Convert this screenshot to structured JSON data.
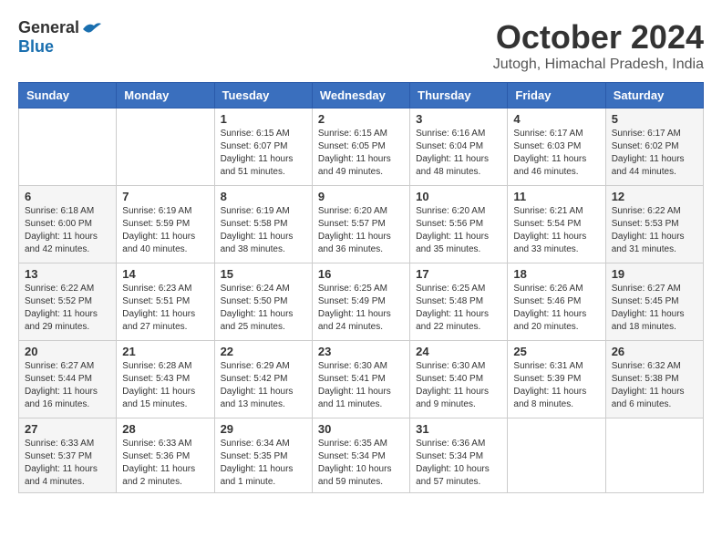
{
  "logo": {
    "general": "General",
    "blue": "Blue"
  },
  "title": "October 2024",
  "location": "Jutogh, Himachal Pradesh, India",
  "headers": [
    "Sunday",
    "Monday",
    "Tuesday",
    "Wednesday",
    "Thursday",
    "Friday",
    "Saturday"
  ],
  "weeks": [
    [
      {
        "day": "",
        "info": ""
      },
      {
        "day": "",
        "info": ""
      },
      {
        "day": "1",
        "info": "Sunrise: 6:15 AM\nSunset: 6:07 PM\nDaylight: 11 hours and 51 minutes."
      },
      {
        "day": "2",
        "info": "Sunrise: 6:15 AM\nSunset: 6:05 PM\nDaylight: 11 hours and 49 minutes."
      },
      {
        "day": "3",
        "info": "Sunrise: 6:16 AM\nSunset: 6:04 PM\nDaylight: 11 hours and 48 minutes."
      },
      {
        "day": "4",
        "info": "Sunrise: 6:17 AM\nSunset: 6:03 PM\nDaylight: 11 hours and 46 minutes."
      },
      {
        "day": "5",
        "info": "Sunrise: 6:17 AM\nSunset: 6:02 PM\nDaylight: 11 hours and 44 minutes."
      }
    ],
    [
      {
        "day": "6",
        "info": "Sunrise: 6:18 AM\nSunset: 6:00 PM\nDaylight: 11 hours and 42 minutes."
      },
      {
        "day": "7",
        "info": "Sunrise: 6:19 AM\nSunset: 5:59 PM\nDaylight: 11 hours and 40 minutes."
      },
      {
        "day": "8",
        "info": "Sunrise: 6:19 AM\nSunset: 5:58 PM\nDaylight: 11 hours and 38 minutes."
      },
      {
        "day": "9",
        "info": "Sunrise: 6:20 AM\nSunset: 5:57 PM\nDaylight: 11 hours and 36 minutes."
      },
      {
        "day": "10",
        "info": "Sunrise: 6:20 AM\nSunset: 5:56 PM\nDaylight: 11 hours and 35 minutes."
      },
      {
        "day": "11",
        "info": "Sunrise: 6:21 AM\nSunset: 5:54 PM\nDaylight: 11 hours and 33 minutes."
      },
      {
        "day": "12",
        "info": "Sunrise: 6:22 AM\nSunset: 5:53 PM\nDaylight: 11 hours and 31 minutes."
      }
    ],
    [
      {
        "day": "13",
        "info": "Sunrise: 6:22 AM\nSunset: 5:52 PM\nDaylight: 11 hours and 29 minutes."
      },
      {
        "day": "14",
        "info": "Sunrise: 6:23 AM\nSunset: 5:51 PM\nDaylight: 11 hours and 27 minutes."
      },
      {
        "day": "15",
        "info": "Sunrise: 6:24 AM\nSunset: 5:50 PM\nDaylight: 11 hours and 25 minutes."
      },
      {
        "day": "16",
        "info": "Sunrise: 6:25 AM\nSunset: 5:49 PM\nDaylight: 11 hours and 24 minutes."
      },
      {
        "day": "17",
        "info": "Sunrise: 6:25 AM\nSunset: 5:48 PM\nDaylight: 11 hours and 22 minutes."
      },
      {
        "day": "18",
        "info": "Sunrise: 6:26 AM\nSunset: 5:46 PM\nDaylight: 11 hours and 20 minutes."
      },
      {
        "day": "19",
        "info": "Sunrise: 6:27 AM\nSunset: 5:45 PM\nDaylight: 11 hours and 18 minutes."
      }
    ],
    [
      {
        "day": "20",
        "info": "Sunrise: 6:27 AM\nSunset: 5:44 PM\nDaylight: 11 hours and 16 minutes."
      },
      {
        "day": "21",
        "info": "Sunrise: 6:28 AM\nSunset: 5:43 PM\nDaylight: 11 hours and 15 minutes."
      },
      {
        "day": "22",
        "info": "Sunrise: 6:29 AM\nSunset: 5:42 PM\nDaylight: 11 hours and 13 minutes."
      },
      {
        "day": "23",
        "info": "Sunrise: 6:30 AM\nSunset: 5:41 PM\nDaylight: 11 hours and 11 minutes."
      },
      {
        "day": "24",
        "info": "Sunrise: 6:30 AM\nSunset: 5:40 PM\nDaylight: 11 hours and 9 minutes."
      },
      {
        "day": "25",
        "info": "Sunrise: 6:31 AM\nSunset: 5:39 PM\nDaylight: 11 hours and 8 minutes."
      },
      {
        "day": "26",
        "info": "Sunrise: 6:32 AM\nSunset: 5:38 PM\nDaylight: 11 hours and 6 minutes."
      }
    ],
    [
      {
        "day": "27",
        "info": "Sunrise: 6:33 AM\nSunset: 5:37 PM\nDaylight: 11 hours and 4 minutes."
      },
      {
        "day": "28",
        "info": "Sunrise: 6:33 AM\nSunset: 5:36 PM\nDaylight: 11 hours and 2 minutes."
      },
      {
        "day": "29",
        "info": "Sunrise: 6:34 AM\nSunset: 5:35 PM\nDaylight: 11 hours and 1 minute."
      },
      {
        "day": "30",
        "info": "Sunrise: 6:35 AM\nSunset: 5:34 PM\nDaylight: 10 hours and 59 minutes."
      },
      {
        "day": "31",
        "info": "Sunrise: 6:36 AM\nSunset: 5:34 PM\nDaylight: 10 hours and 57 minutes."
      },
      {
        "day": "",
        "info": ""
      },
      {
        "day": "",
        "info": ""
      }
    ]
  ]
}
